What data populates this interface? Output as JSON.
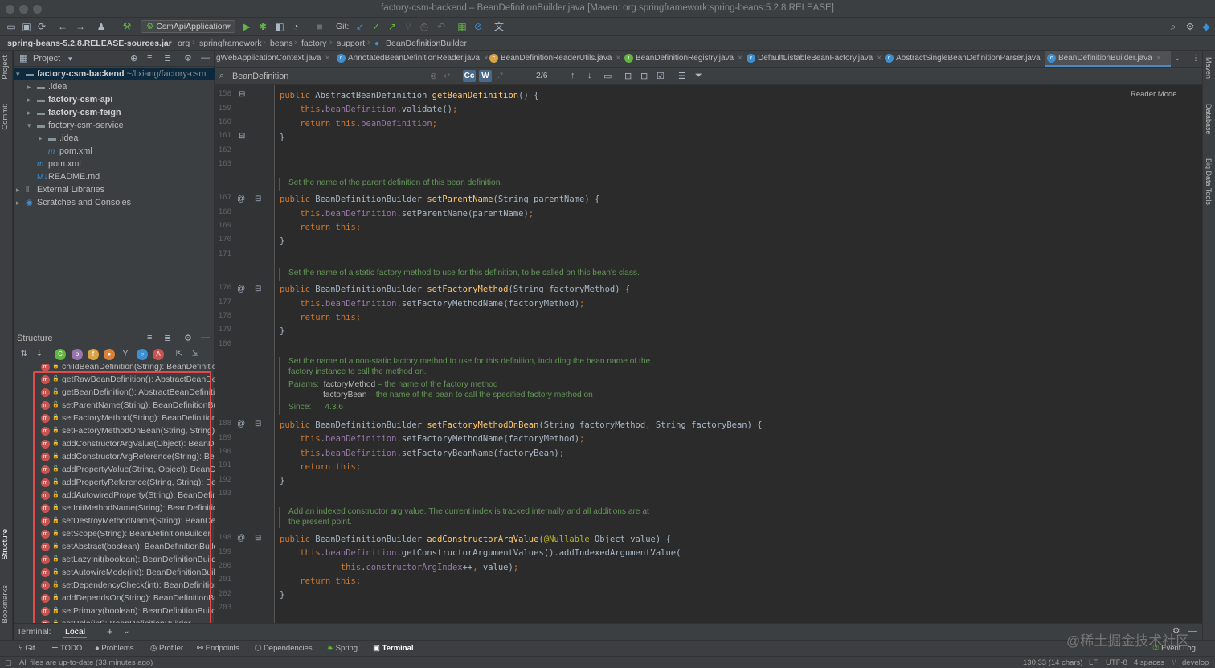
{
  "window": {
    "title": "factory-csm-backend – BeanDefinitionBuilder.java [Maven: org.springframework:spring-beans:5.2.8.RELEASE]"
  },
  "toolbar": {
    "run_config": "CsmApiApplication",
    "git_label": "Git:"
  },
  "breadcrumbs": [
    "spring-beans-5.2.8.RELEASE-sources.jar",
    "org",
    "springframework",
    "beans",
    "factory",
    "support",
    "BeanDefinitionBuilder"
  ],
  "left_strip": {
    "project": "Project",
    "commit": "Commit",
    "structure": "Structure",
    "bookmarks": "Bookmarks"
  },
  "right_strip": {
    "maven": "Maven",
    "database": "Database",
    "big_data": "Big Data Tools"
  },
  "project_panel": {
    "title": "Project",
    "tree": [
      {
        "label": "factory-csm-backend",
        "path": "~/lixiang/factory-csm",
        "bold": true
      },
      {
        "label": ".idea"
      },
      {
        "label": "factory-csm-api",
        "bold": true
      },
      {
        "label": "factory-csm-feign",
        "bold": true
      },
      {
        "label": "factory-csm-service"
      },
      {
        "label": ".idea"
      },
      {
        "label": "pom.xml"
      },
      {
        "label": "pom.xml"
      },
      {
        "label": "README.md"
      },
      {
        "label": "External Libraries"
      },
      {
        "label": "Scratches and Consoles"
      }
    ]
  },
  "structure_panel": {
    "title": "Structure",
    "items": [
      "childBeanDefinition(String): BeanDefinitionBuilder",
      "getRawBeanDefinition(): AbstractBeanDefinition",
      "getBeanDefinition(): AbstractBeanDefinition",
      "setParentName(String): BeanDefinitionBuilder",
      "setFactoryMethod(String): BeanDefinitionBuilder",
      "setFactoryMethodOnBean(String, String): BeanDefinitionBuilder",
      "addConstructorArgValue(Object): BeanDefinitionBuilder",
      "addConstructorArgReference(String): BeanDefinitionBuilder",
      "addPropertyValue(String, Object): BeanDefinitionBuilder",
      "addPropertyReference(String, String): BeanDefinitionBuilder",
      "addAutowiredProperty(String): BeanDefinitionBuilder",
      "setInitMethodName(String): BeanDefinitionBuilder",
      "setDestroyMethodName(String): BeanDefinitionBuilder",
      "setScope(String): BeanDefinitionBuilder",
      "setAbstract(boolean): BeanDefinitionBuilder",
      "setLazyInit(boolean): BeanDefinitionBuilder",
      "setAutowireMode(int): BeanDefinitionBuilder",
      "setDependencyCheck(int): BeanDefinitionBuilder",
      "addDependsOn(String): BeanDefinitionBuilder",
      "setPrimary(boolean): BeanDefinitionBuilder",
      "setRole(int): BeanDefinitionBuilder"
    ]
  },
  "editor_tabs": [
    {
      "label": "gWebApplicationContext.java"
    },
    {
      "label": "AnnotatedBeanDefinitionReader.java"
    },
    {
      "label": "BeanDefinitionReaderUtils.java"
    },
    {
      "label": "BeanDefinitionRegistry.java"
    },
    {
      "label": "DefaultListableBeanFactory.java"
    },
    {
      "label": "AbstractSingleBeanDefinitionParser.java"
    },
    {
      "label": "BeanDefinitionBuilder.java",
      "active": true
    }
  ],
  "find": {
    "query": "BeanDefinition",
    "count": "2/6",
    "match_case": "Cc",
    "words": "W"
  },
  "editor": {
    "reader_mode": "Reader Mode",
    "line_numbers": [
      "158",
      "159",
      "160",
      "161",
      "162",
      "163",
      "167",
      "168",
      "169",
      "170",
      "171",
      "176",
      "177",
      "178",
      "179",
      "180",
      "188",
      "189",
      "190",
      "191",
      "192",
      "193",
      "198",
      "199",
      "200",
      "201",
      "202",
      "203"
    ],
    "doc1": "Set the name of the parent definition of this bean definition.",
    "doc2": "Set the name of a static factory method to use for this definition, to be called on this bean's class.",
    "doc3_line1": "Set the name of a non-static factory method to use for this definition, including the bean name of the",
    "doc3_line2": "factory instance to call the method on.",
    "doc3_params": "Params:",
    "doc3_p1_name": "factoryMethod",
    "doc3_p1_desc": " – the name of the factory method",
    "doc3_p2_name": "factoryBean",
    "doc3_p2_desc": " – the name of the bean to call the specified factory method on",
    "doc3_since": "Since:",
    "doc3_since_val": "4.3.6",
    "doc4_line1": "Add an indexed constructor arg value. The current index is tracked internally and all additions are at",
    "doc4_line2": "the present point."
  },
  "terminal": {
    "label": "Terminal:",
    "tab": "Local"
  },
  "bottom_tabs": [
    "Git",
    "TODO",
    "Problems",
    "Profiler",
    "Endpoints",
    "Dependencies",
    "Spring",
    "Terminal"
  ],
  "event_log": "Event Log",
  "status": {
    "message": "All files are up-to-date (33 minutes ago)",
    "position": "130:33 (14 chars)",
    "line_sep": "LF",
    "encoding": "UTF-8",
    "indent": "4 spaces",
    "branch": "develop"
  },
  "watermark": "@稀土掘金技术社区"
}
